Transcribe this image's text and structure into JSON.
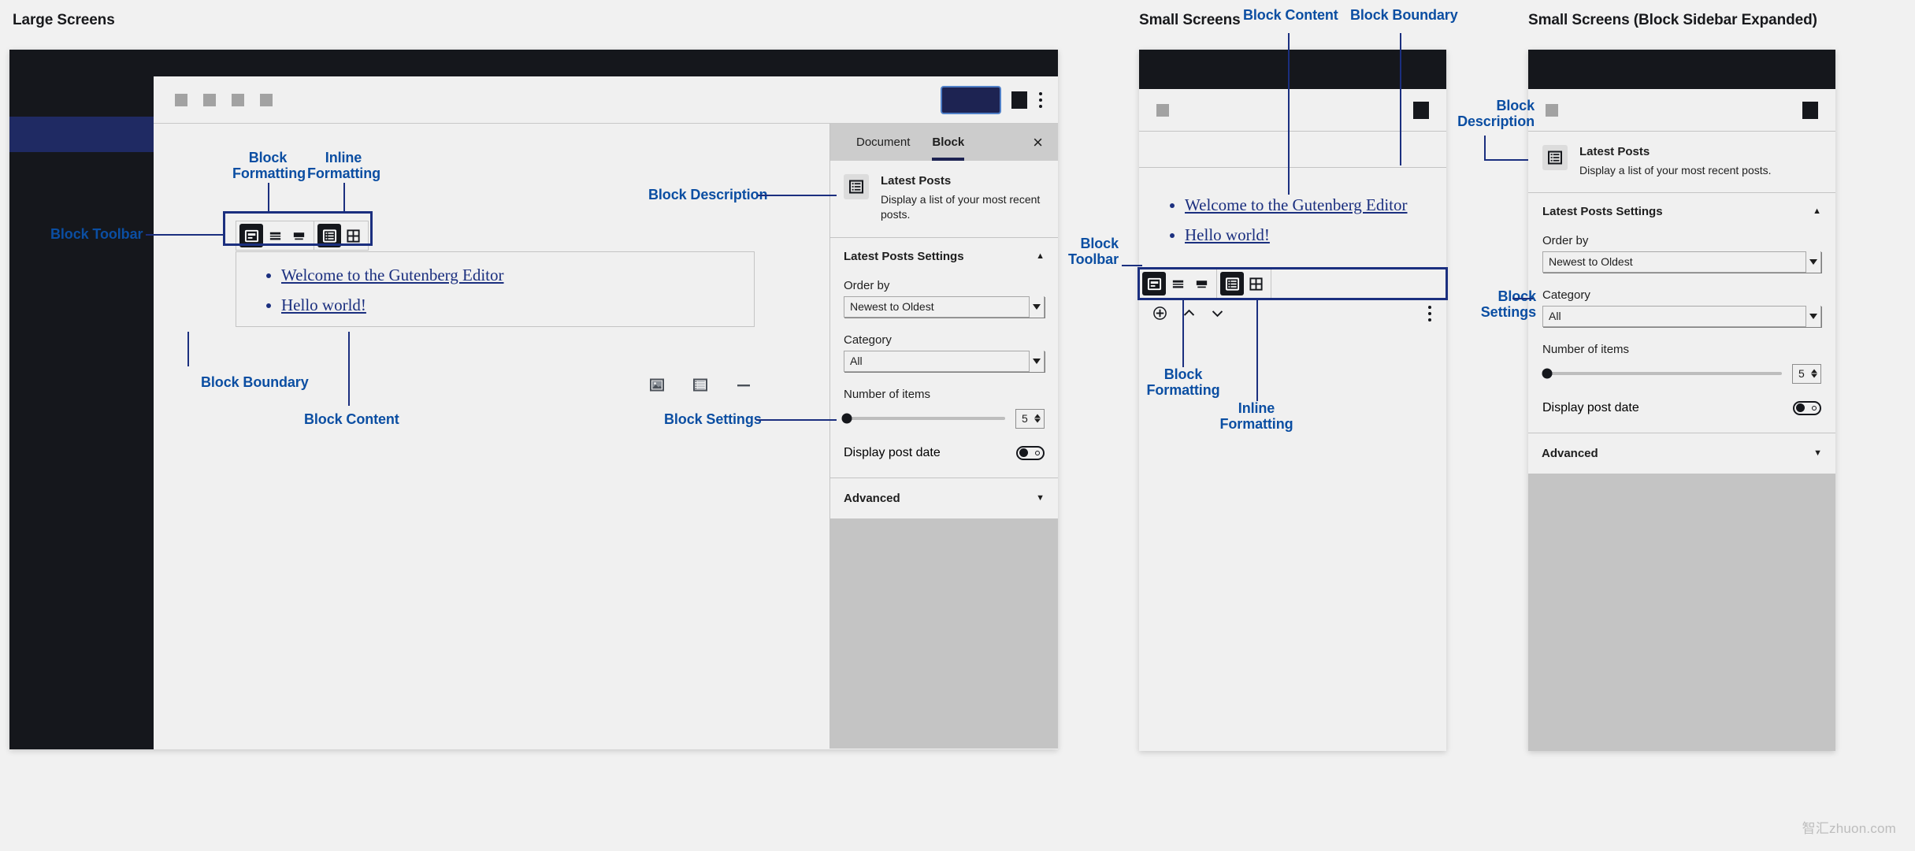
{
  "sections": {
    "large": "Large Screens",
    "small": "Small Screens",
    "small_expanded": "Small Screens (Block Sidebar Expanded)"
  },
  "annotations": {
    "block_formatting": "Block\nFormatting",
    "inline_formatting": "Inline\nFormatting",
    "block_toolbar": "Block Toolbar",
    "block_toolbar_2line": "Block\nToolbar",
    "block_boundary": "Block Boundary",
    "block_content": "Block Content",
    "block_description": "Block Description",
    "block_description_2line": "Block\nDescription",
    "block_settings": "Block Settings",
    "block_settings_2line": "Block\nSettings"
  },
  "editor": {
    "toolbar_icons": [
      "block-align-left-icon",
      "block-align-center-icon",
      "block-align-wide-icon",
      "list-view-icon",
      "table-icon"
    ],
    "content_items": [
      "Welcome to the Gutenberg Editor",
      "Hello world!"
    ],
    "bottom_icons": [
      "image-placeholder-icon",
      "list-placeholder-icon",
      "separator-icon"
    ],
    "bottom_bar_icons": [
      "add-block-icon",
      "move-up-icon",
      "move-down-icon",
      "more-options-icon"
    ]
  },
  "sidebar": {
    "tabs": [
      {
        "label": "Document",
        "active": false
      },
      {
        "label": "Block",
        "active": true
      }
    ],
    "close_label": "×",
    "block": {
      "title": "Latest Posts",
      "description": "Display a list of your most recent posts.",
      "description_short": "Display a list of your most recent posts.",
      "icon": "latest-posts-icon"
    },
    "settings_panel": {
      "title": "Latest Posts Settings",
      "expanded_caret": "▲",
      "fields": {
        "order_by_label": "Order by",
        "order_by_value": "Newest to Oldest",
        "category_label": "Category",
        "category_value": "All",
        "number_of_items_label": "Number of items",
        "number_of_items_value": "5",
        "display_post_date_label": "Display post date"
      }
    },
    "advanced": {
      "title": "Advanced",
      "collapsed_caret": "▼"
    }
  },
  "watermark": "智汇zhuon.com",
  "colors": {
    "accent_blue": "#0b4ea2",
    "leader_navy": "#1b2f7f",
    "editor_bg": "#f0f0f0",
    "chrome_dark": "#15171c",
    "primary_button": "#1d2352",
    "sidebar_tabs_bg": "#cccccc"
  }
}
